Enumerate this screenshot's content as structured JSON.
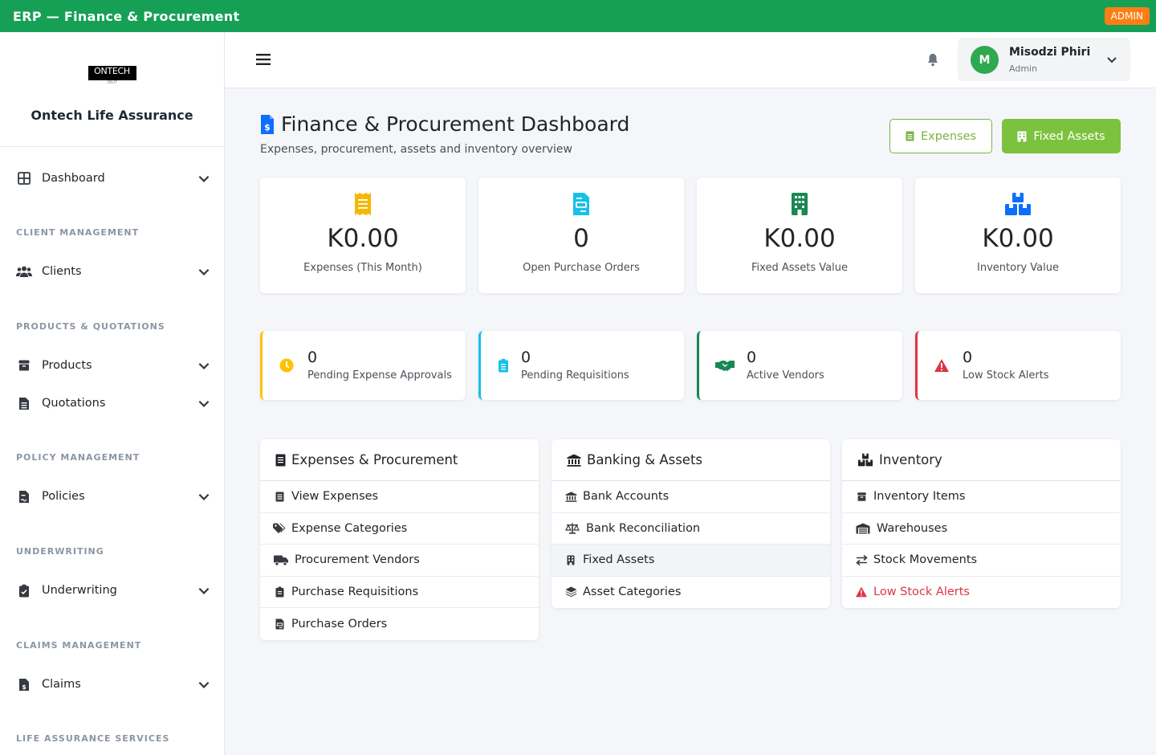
{
  "topbar": {
    "title": "ERP — Finance & Procurement",
    "role_badge": "ADMIN"
  },
  "sidebar": {
    "logo_text": "ONTECH",
    "logo_subtext": "ON.IT",
    "company": "Ontech Life Assurance",
    "sections": {
      "client_management": "CLIENT MANAGEMENT",
      "products_quotations": "PRODUCTS & QUOTATIONS",
      "policy_management": "POLICY MANAGEMENT",
      "underwriting": "UNDERWRITING",
      "claims_management": "CLAIMS MANAGEMENT",
      "life_assurance_services": "LIFE ASSURANCE SERVICES"
    },
    "items": {
      "dashboard": "Dashboard",
      "clients": "Clients",
      "products": "Products",
      "quotations": "Quotations",
      "policies": "Policies",
      "underwriting": "Underwriting",
      "claims": "Claims"
    }
  },
  "header": {
    "user_name": "Misodzi Phiri",
    "user_role": "Admin",
    "avatar_initial": "M"
  },
  "page": {
    "title": "Finance & Procurement Dashboard",
    "subtitle": "Expenses, procurement, assets and inventory overview",
    "buttons": {
      "expenses": "Expenses",
      "fixed_assets": "Fixed Assets"
    }
  },
  "stats": [
    {
      "value": "K0.00",
      "label": "Expenses (This Month)",
      "icon": "receipt-icon",
      "color": "#f5b800"
    },
    {
      "value": "0",
      "label": "Open Purchase Orders",
      "icon": "file-invoice-icon",
      "color": "#17c1e8"
    },
    {
      "value": "K0.00",
      "label": "Fixed Assets Value",
      "icon": "building-icon",
      "color": "#198754"
    },
    {
      "value": "K0.00",
      "label": "Inventory Value",
      "icon": "boxes-icon",
      "color": "#0d6efd"
    }
  ],
  "alerts": [
    {
      "value": "0",
      "label": "Pending Expense Approvals",
      "icon": "clock-icon",
      "color": "#ffc107"
    },
    {
      "value": "0",
      "label": "Pending Requisitions",
      "icon": "clipboard-icon",
      "color": "#17c1e8"
    },
    {
      "value": "0",
      "label": "Active Vendors",
      "icon": "handshake-icon",
      "color": "#198754"
    },
    {
      "value": "0",
      "label": "Low Stock Alerts",
      "icon": "warning-icon",
      "color": "#dc3545"
    }
  ],
  "panels": {
    "expenses": {
      "title": "Expenses & Procurement",
      "links": [
        "View Expenses",
        "Expense Categories",
        "Procurement Vendors",
        "Purchase Requisitions",
        "Purchase Orders"
      ]
    },
    "banking": {
      "title": "Banking & Assets",
      "links": [
        "Bank Accounts",
        "Bank Reconciliation",
        "Fixed Assets",
        "Asset Categories"
      ]
    },
    "inventory": {
      "title": "Inventory",
      "links": [
        "Inventory Items",
        "Warehouses",
        "Stock Movements",
        "Low Stock Alerts"
      ]
    }
  }
}
